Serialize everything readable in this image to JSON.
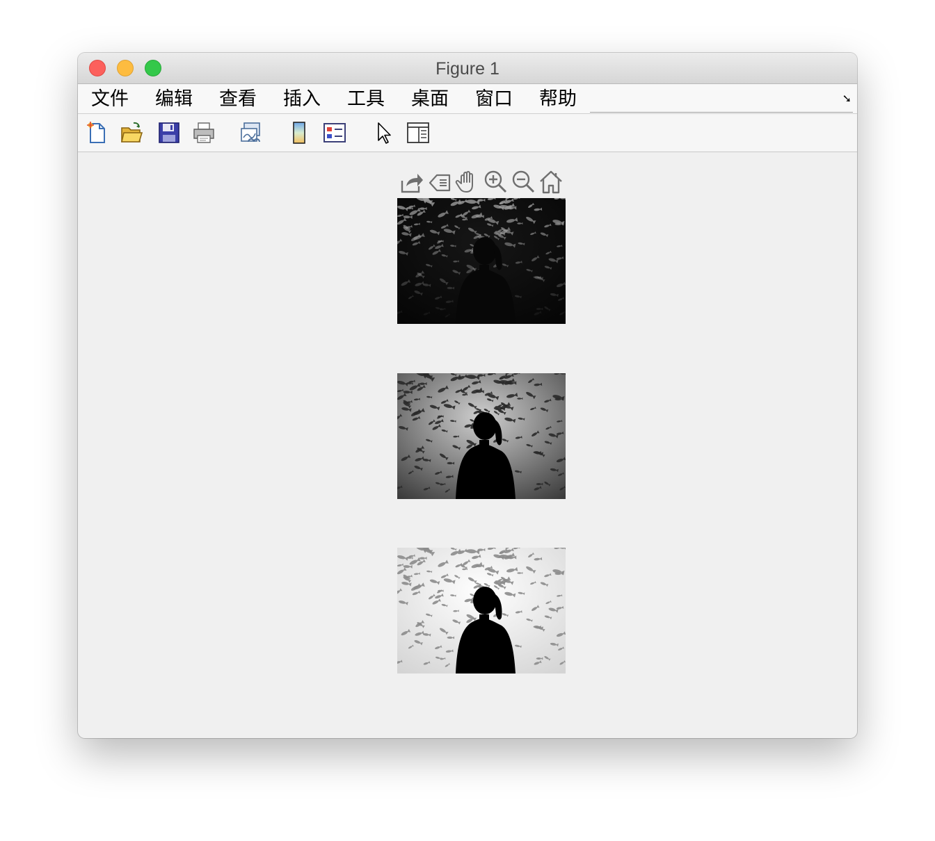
{
  "window": {
    "title": "Figure 1"
  },
  "menubar": {
    "items": [
      "文件",
      "编辑",
      "查看",
      "插入",
      "工具",
      "桌面",
      "窗口",
      "帮助"
    ]
  },
  "toolbar": {
    "tools": [
      "new-figure-icon",
      "open-file-icon",
      "save-icon",
      "print-icon",
      "link-plot-icon",
      "insert-colorbar-icon",
      "insert-legend-icon",
      "edit-plot-arrow-icon",
      "property-inspector-icon"
    ]
  },
  "axes_toolbar": {
    "tools": [
      "export-icon",
      "brush-icon",
      "pan-hand-icon",
      "zoom-in-icon",
      "zoom-out-icon",
      "restore-view-home-icon"
    ]
  },
  "images": [
    {
      "name": "very-dark-image",
      "tone": "dark",
      "colors": {
        "background": "#0b0b0b",
        "fish": "#9a9a9a"
      }
    },
    {
      "name": "original-grayscale-image",
      "tone": "medium",
      "colors": {
        "background": "#a6a6a6",
        "fish": "#2a2a2a"
      }
    },
    {
      "name": "brightened-image",
      "tone": "bright",
      "colors": {
        "background": "#f6f6f6",
        "fish": "#8c8c8c"
      }
    }
  ]
}
